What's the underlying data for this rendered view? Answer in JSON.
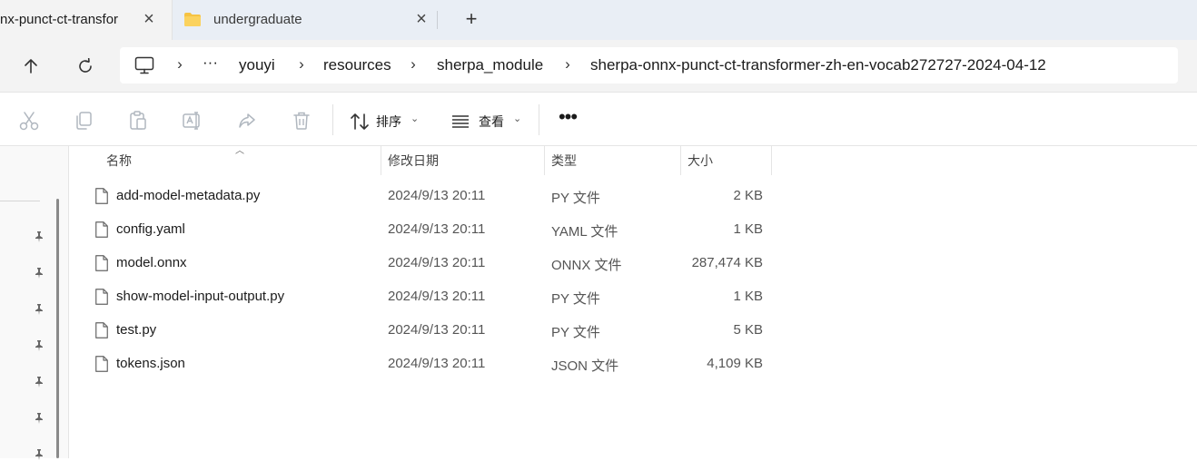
{
  "tabs": [
    {
      "label": "nx-punct-ct-transfor",
      "active": true,
      "icon": "none"
    },
    {
      "label": "undergraduate",
      "active": false,
      "icon": "folder-icon"
    }
  ],
  "new_tab_label": "+",
  "nav": {
    "up_icon": "arrow-up-icon",
    "refresh_icon": "refresh-icon"
  },
  "breadcrumb": {
    "overflow": "···",
    "items": [
      "youyi",
      "resources",
      "sherpa_module",
      "sherpa-onnx-punct-ct-transformer-zh-en-vocab272727-2024-04-12"
    ]
  },
  "toolbar": {
    "sort_label": "排序",
    "view_label": "查看",
    "more_label": "•••",
    "icons": [
      "cut-icon",
      "copy-icon",
      "paste-icon",
      "rename-icon",
      "share-icon",
      "delete-icon"
    ]
  },
  "columns": {
    "name": "名称",
    "date": "修改日期",
    "type": "类型",
    "size": "大小"
  },
  "files": [
    {
      "name": "add-model-metadata.py",
      "date": "2024/9/13 20:11",
      "type": "PY 文件",
      "size": "2 KB"
    },
    {
      "name": "config.yaml",
      "date": "2024/9/13 20:11",
      "type": "YAML 文件",
      "size": "1 KB"
    },
    {
      "name": "model.onnx",
      "date": "2024/9/13 20:11",
      "type": "ONNX 文件",
      "size": "287,474 KB"
    },
    {
      "name": "show-model-input-output.py",
      "date": "2024/9/13 20:11",
      "type": "PY 文件",
      "size": "1 KB"
    },
    {
      "name": "test.py",
      "date": "2024/9/13 20:11",
      "type": "PY 文件",
      "size": "5 KB"
    },
    {
      "name": "tokens.json",
      "date": "2024/9/13 20:11",
      "type": "JSON 文件",
      "size": "4,109 KB"
    }
  ],
  "colors": {
    "tabstrip_bg": "#e9eef5",
    "folder_yellow": "#f6c343"
  }
}
